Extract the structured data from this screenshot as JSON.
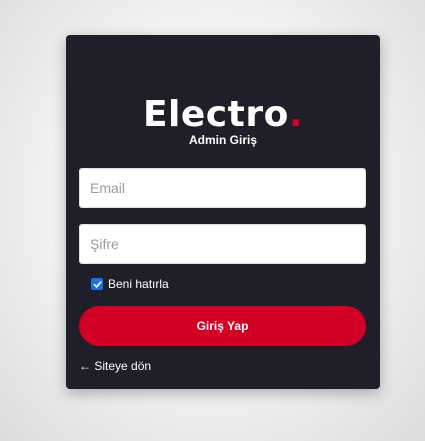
{
  "brand": {
    "name": "Electro",
    "dot": "."
  },
  "login": {
    "title": "Admin Giriş",
    "email_placeholder": "Email",
    "password_placeholder": "Şifre",
    "remember_label": "Beni hatırla",
    "remember_checked": true,
    "submit_label": "Giriş Yap",
    "back_link": "← Siteye dön"
  },
  "colors": {
    "card_bg": "#1e1f29",
    "accent": "#d10024",
    "checkbox": "#1a73e8"
  }
}
